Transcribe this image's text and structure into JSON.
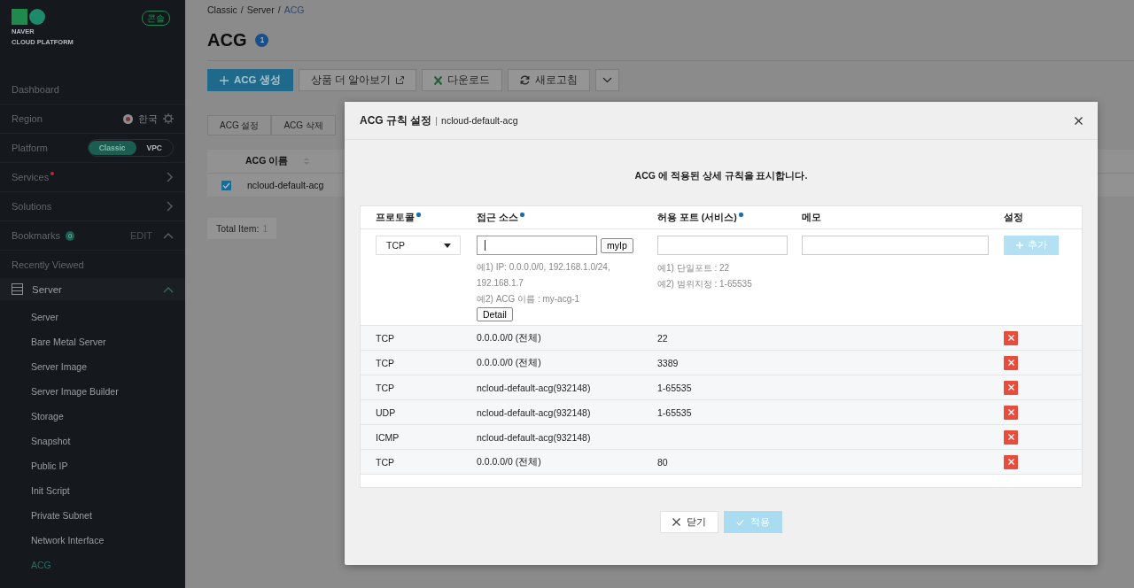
{
  "sidebar": {
    "logo_lines": [
      "NAVER",
      "CLOUD PLATFORM"
    ],
    "console_badge": "콘솔",
    "menu": [
      {
        "kind": "link",
        "label": "Dashboard"
      },
      {
        "kind": "region",
        "label": "Region",
        "value": "한국"
      },
      {
        "kind": "platform",
        "label": "Platform",
        "options": [
          {
            "label": "Classic",
            "selected": true
          },
          {
            "label": "VPC",
            "selected": false
          }
        ]
      },
      {
        "kind": "nav",
        "label": "Services",
        "marked": true
      },
      {
        "kind": "nav",
        "label": "Solutions",
        "marked": false
      },
      {
        "kind": "bookmarks",
        "label": "Bookmarks",
        "count": "0",
        "action": "EDIT",
        "expanded": true
      },
      {
        "kind": "link",
        "label": "Recently Viewed"
      },
      {
        "kind": "group",
        "label": "Server",
        "expanded": true,
        "children": [
          {
            "label": "Server",
            "selected": false
          },
          {
            "label": "Bare Metal Server",
            "selected": false
          },
          {
            "label": "Server Image",
            "selected": false
          },
          {
            "label": "Server Image Builder",
            "selected": false
          },
          {
            "label": "Storage",
            "selected": false
          },
          {
            "label": "Snapshot",
            "selected": false
          },
          {
            "label": "Public IP",
            "selected": false
          },
          {
            "label": "Init Script",
            "selected": false
          },
          {
            "label": "Private Subnet",
            "selected": false
          },
          {
            "label": "Network Interface",
            "selected": false
          },
          {
            "label": "ACG",
            "selected": true
          }
        ]
      }
    ]
  },
  "main": {
    "breadcrumb": [
      "Classic",
      "Server",
      "ACG"
    ],
    "breadcrumb_separator": "/",
    "title": "ACG",
    "count": "1",
    "toolbar": [
      {
        "kind": "primary",
        "label": "ACG 생성"
      },
      {
        "kind": "external",
        "label": "상품 더 알아보기"
      },
      {
        "kind": "excel",
        "label": "다운로드"
      },
      {
        "kind": "refresh",
        "label": "새로고침"
      },
      {
        "kind": "more"
      }
    ],
    "actions": [
      "ACG 설정",
      "ACG 삭제"
    ],
    "table": {
      "columns": [
        "ACG 이름"
      ],
      "rows": [
        {
          "checked": true,
          "cells": [
            "ncloud-default-acg"
          ]
        }
      ]
    },
    "total": {
      "label": "Total Item:",
      "value": "1"
    }
  },
  "modal": {
    "title": "ACG 규칙 설정",
    "separator": "|",
    "subtitle": "ncloud-default-acg",
    "description": "ACG 에 적용된 상세 규칙을 표시합니다.",
    "columns": [
      {
        "label": "프로토콜",
        "required": true
      },
      {
        "label": "접근 소스",
        "required": true
      },
      {
        "label": "허용 포트 (서비스)",
        "required": true
      },
      {
        "label": "메모",
        "required": false
      },
      {
        "label": "설정",
        "required": false
      }
    ],
    "form": {
      "protocol": "TCP",
      "source_focused": true,
      "myip_button": "myIp",
      "source_hints": [
        "예1) IP: 0.0.0.0/0, 192.168.1.0/24, 192.168.1.7",
        "예2) ACG 이름 : my-acg-1"
      ],
      "detail_button": "Detail",
      "port_hints": [
        "예1) 단일포트 : 22",
        "예2) 범위지정 : 1-65535"
      ],
      "add_button": {
        "label": "추가",
        "disabled": true
      }
    },
    "rules": [
      {
        "protocol": "TCP",
        "source": "0.0.0.0/0 (전체)",
        "port": "22"
      },
      {
        "protocol": "TCP",
        "source": "0.0.0.0/0 (전체)",
        "port": "3389"
      },
      {
        "protocol": "TCP",
        "source": "ncloud-default-acg(932148)",
        "port": "1-65535"
      },
      {
        "protocol": "UDP",
        "source": "ncloud-default-acg(932148)",
        "port": "1-65535"
      },
      {
        "protocol": "ICMP",
        "source": "ncloud-default-acg(932148)"
      },
      {
        "protocol": "TCP",
        "source": "0.0.0.0/0 (전체)",
        "port": "80"
      }
    ],
    "close_button": "닫기",
    "apply_button": {
      "label": "적용",
      "disabled": true
    }
  }
}
